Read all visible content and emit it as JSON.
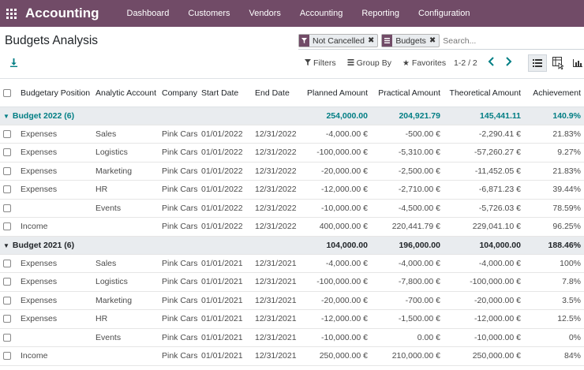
{
  "navbar": {
    "brand": "Accounting",
    "menu": [
      "Dashboard",
      "Customers",
      "Vendors",
      "Accounting",
      "Reporting",
      "Configuration"
    ]
  },
  "page": {
    "title": "Budgets Analysis"
  },
  "search": {
    "facets": [
      {
        "icon": "filter-icon",
        "label": "Not Cancelled"
      },
      {
        "icon": "group-by-icon",
        "label": "Budgets"
      }
    ],
    "placeholder": "Search..."
  },
  "toolbar": {
    "filters_label": "Filters",
    "groupby_label": "Group By",
    "favorites_label": "Favorites",
    "pager_value": "1-2 / 2"
  },
  "table": {
    "columns": [
      "Budgetary Position",
      "Analytic Account",
      "Company",
      "Start Date",
      "End Date",
      "Planned Amount",
      "Practical Amount",
      "Theoretical Amount",
      "Achievement"
    ],
    "groups": [
      {
        "name": "Budget 2022 (6)",
        "planned": "254,000.00",
        "practical": "204,921.79",
        "theoretical": "145,441.11",
        "achievement": "140.9%",
        "rows": [
          {
            "position": "Expenses",
            "account": "Sales",
            "company": "Pink Cars",
            "start": "01/01/2022",
            "end": "12/31/2022",
            "planned": "-4,000.00 €",
            "practical": "-500.00 €",
            "theoretical": "-2,290.41 €",
            "achievement": "21.83%"
          },
          {
            "position": "Expenses",
            "account": "Logistics",
            "company": "Pink Cars",
            "start": "01/01/2022",
            "end": "12/31/2022",
            "planned": "-100,000.00 €",
            "practical": "-5,310.00 €",
            "theoretical": "-57,260.27 €",
            "achievement": "9.27%"
          },
          {
            "position": "Expenses",
            "account": "Marketing",
            "company": "Pink Cars",
            "start": "01/01/2022",
            "end": "12/31/2022",
            "planned": "-20,000.00 €",
            "practical": "-2,500.00 €",
            "theoretical": "-11,452.05 €",
            "achievement": "21.83%"
          },
          {
            "position": "Expenses",
            "account": "HR",
            "company": "Pink Cars",
            "start": "01/01/2022",
            "end": "12/31/2022",
            "planned": "-12,000.00 €",
            "practical": "-2,710.00 €",
            "theoretical": "-6,871.23 €",
            "achievement": "39.44%"
          },
          {
            "position": "",
            "account": "Events",
            "company": "Pink Cars",
            "start": "01/01/2022",
            "end": "12/31/2022",
            "planned": "-10,000.00 €",
            "practical": "-4,500.00 €",
            "theoretical": "-5,726.03 €",
            "achievement": "78.59%"
          },
          {
            "position": "Income",
            "account": "",
            "company": "Pink Cars",
            "start": "01/01/2022",
            "end": "12/31/2022",
            "planned": "400,000.00 €",
            "practical": "220,441.79 €",
            "theoretical": "229,041.10 €",
            "achievement": "96.25%"
          }
        ]
      },
      {
        "name": "Budget 2021 (6)",
        "planned": "104,000.00",
        "practical": "196,000.00",
        "theoretical": "104,000.00",
        "achievement": "188.46%",
        "rows": [
          {
            "position": "Expenses",
            "account": "Sales",
            "company": "Pink Cars",
            "start": "01/01/2021",
            "end": "12/31/2021",
            "planned": "-4,000.00 €",
            "practical": "-4,000.00 €",
            "theoretical": "-4,000.00 €",
            "achievement": "100%"
          },
          {
            "position": "Expenses",
            "account": "Logistics",
            "company": "Pink Cars",
            "start": "01/01/2021",
            "end": "12/31/2021",
            "planned": "-100,000.00 €",
            "practical": "-7,800.00 €",
            "theoretical": "-100,000.00 €",
            "achievement": "7.8%"
          },
          {
            "position": "Expenses",
            "account": "Marketing",
            "company": "Pink Cars",
            "start": "01/01/2021",
            "end": "12/31/2021",
            "planned": "-20,000.00 €",
            "practical": "-700.00 €",
            "theoretical": "-20,000.00 €",
            "achievement": "3.5%"
          },
          {
            "position": "Expenses",
            "account": "HR",
            "company": "Pink Cars",
            "start": "01/01/2021",
            "end": "12/31/2021",
            "planned": "-12,000.00 €",
            "practical": "-1,500.00 €",
            "theoretical": "-12,000.00 €",
            "achievement": "12.5%"
          },
          {
            "position": "",
            "account": "Events",
            "company": "Pink Cars",
            "start": "01/01/2021",
            "end": "12/31/2021",
            "planned": "-10,000.00 €",
            "practical": "0.00 €",
            "theoretical": "-10,000.00 €",
            "achievement": "0%"
          },
          {
            "position": "Income",
            "account": "",
            "company": "Pink Cars",
            "start": "01/01/2021",
            "end": "12/31/2021",
            "planned": "250,000.00 €",
            "practical": "210,000.00 €",
            "theoretical": "250,000.00 €",
            "achievement": "84%"
          }
        ]
      }
    ]
  }
}
